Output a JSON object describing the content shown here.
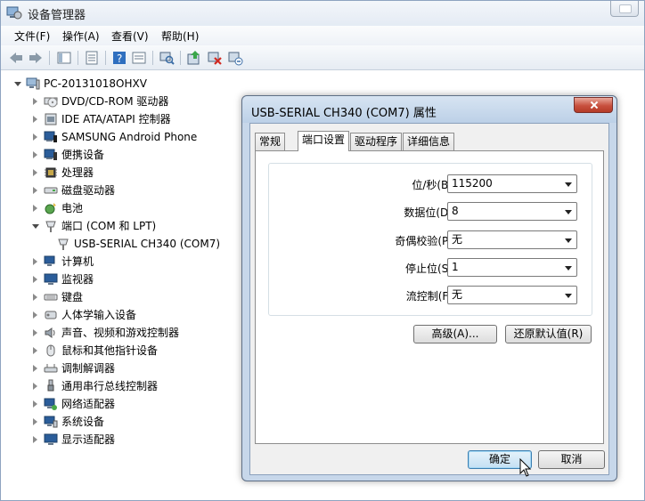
{
  "window": {
    "title": "设备管理器"
  },
  "menu": [
    "文件(F)",
    "操作(A)",
    "查看(V)",
    "帮助(H)"
  ],
  "toolbar_icons": [
    "back-icon",
    "forward-icon",
    "tree-view-icon",
    "properties-icon",
    "help-icon",
    "details-icon",
    "scan-hardware-icon",
    "update-driver-icon",
    "uninstall-icon",
    "disable-icon"
  ],
  "tree": {
    "root": "PC-20131018OHXV",
    "items": [
      {
        "label": "DVD/CD-ROM 驱动器",
        "icon": "dvd-drive-icon"
      },
      {
        "label": "IDE ATA/ATAPI 控制器",
        "icon": "ide-controller-icon"
      },
      {
        "label": "SAMSUNG Android Phone",
        "icon": "phone-icon"
      },
      {
        "label": "便携设备",
        "icon": "portable-device-icon"
      },
      {
        "label": "处理器",
        "icon": "processor-icon"
      },
      {
        "label": "磁盘驱动器",
        "icon": "disk-drive-icon"
      },
      {
        "label": "电池",
        "icon": "battery-icon"
      },
      {
        "label": "端口 (COM 和 LPT)",
        "icon": "port-icon"
      },
      {
        "label": "USB-SERIAL CH340 (COM7)",
        "icon": "port-icon"
      },
      {
        "label": "计算机",
        "icon": "computer-icon"
      },
      {
        "label": "监视器",
        "icon": "monitor-icon"
      },
      {
        "label": "键盘",
        "icon": "keyboard-icon"
      },
      {
        "label": "人体学输入设备",
        "icon": "hid-icon"
      },
      {
        "label": "声音、视频和游戏控制器",
        "icon": "sound-icon"
      },
      {
        "label": "鼠标和其他指针设备",
        "icon": "mouse-icon"
      },
      {
        "label": "调制解调器",
        "icon": "modem-icon"
      },
      {
        "label": "通用串行总线控制器",
        "icon": "usb-icon"
      },
      {
        "label": "网络适配器",
        "icon": "network-icon"
      },
      {
        "label": "系统设备",
        "icon": "system-device-icon"
      },
      {
        "label": "显示适配器",
        "icon": "display-adapter-icon"
      }
    ]
  },
  "dialog": {
    "title": "USB-SERIAL CH340 (COM7) 属性",
    "tabs": [
      "常规",
      "端口设置",
      "驱动程序",
      "详细信息"
    ],
    "active_tab": "端口设置",
    "fields": [
      {
        "label": "位/秒(B):",
        "value": "115200"
      },
      {
        "label": "数据位(D):",
        "value": "8"
      },
      {
        "label": "奇偶校验(P):",
        "value": "无"
      },
      {
        "label": "停止位(S):",
        "value": "1"
      },
      {
        "label": "流控制(F):",
        "value": "无"
      }
    ],
    "advanced_button": "高级(A)...",
    "restore_button": "还原默认值(R)",
    "ok_button": "确定",
    "cancel_button": "取消"
  }
}
